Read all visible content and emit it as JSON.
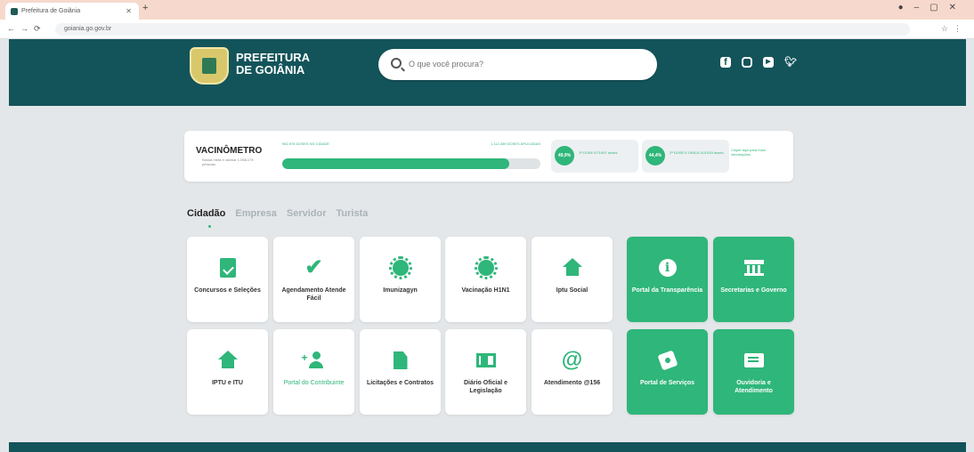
{
  "browser": {
    "tab_title": "Prefeitura de Goiânia",
    "url": "goiania.go.gov.br"
  },
  "header": {
    "logo_line1": "PREFEITURA",
    "logo_line2": "DE GOIÂNIA",
    "search_placeholder": "O que você procura?"
  },
  "vacinometro": {
    "title": "VACINÔMETRO",
    "subtitle": "Nossa meta é vacinar 1.058.175 pessoas",
    "left_label": "981.978 DOSES NO CIDADE",
    "right_label": "1.112.459 DOSES APLICADAS",
    "progress": 0.88,
    "pill1_pct": "49,9%",
    "pill1_text": "1ª DOSE 673.897 doses",
    "pill2_pct": "44,4%",
    "pill2_text": "2ª DOSE E ÚNICA 315.516 doses",
    "more_text": "Clique aqui para mais informações"
  },
  "tabs": [
    "Cidadão",
    "Empresa",
    "Servidor",
    "Turista"
  ],
  "cards": [
    {
      "label": "Concursos e Seleções",
      "icon": "clipboard-check-icon"
    },
    {
      "label": "Agendamento Atende Fácil",
      "icon": "check-icon"
    },
    {
      "label": "Imunizagyn",
      "icon": "virus-icon"
    },
    {
      "label": "Vacinação H1N1",
      "icon": "virus-icon"
    },
    {
      "label": "Iptu Social",
      "icon": "home-icon"
    },
    {
      "label": "Portal da Transparência",
      "icon": "info-icon"
    },
    {
      "label": "Secretarias e Governo",
      "icon": "bank-icon"
    },
    {
      "label": "IPTU e ITU",
      "icon": "home-icon"
    },
    {
      "label": "Portal do Contribuinte",
      "icon": "person-add-icon"
    },
    {
      "label": "Licitações e Contratos",
      "icon": "document-icon"
    },
    {
      "label": "Diário Oficial e Legislação",
      "icon": "book-icon"
    },
    {
      "label": "Atendimento @156",
      "icon": "at-icon"
    },
    {
      "label": "Portal de Serviços",
      "icon": "tags-icon"
    },
    {
      "label": "Ouvidoria e Atendimento",
      "icon": "chat-icon"
    }
  ],
  "colors": {
    "primary_dark": "#13545a",
    "accent_green": "#2fb67a"
  }
}
